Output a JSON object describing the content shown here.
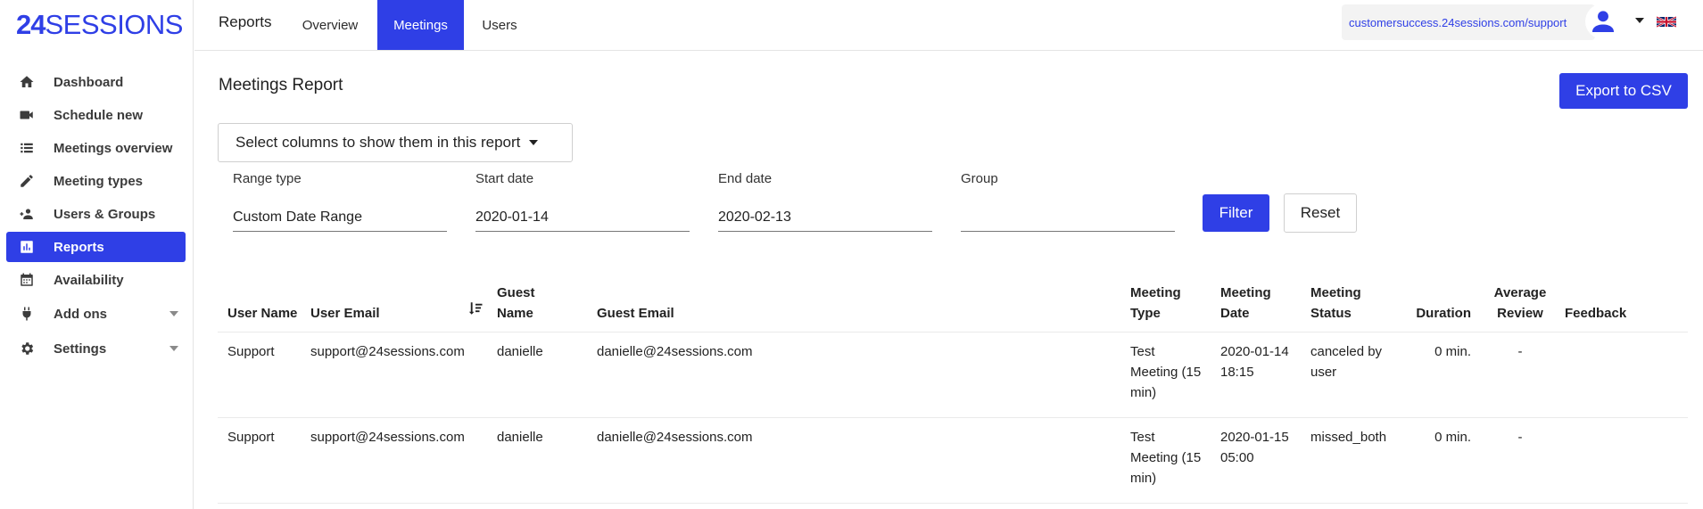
{
  "brand": {
    "logo_bold": "24",
    "logo_light": "SESSIONS",
    "accent": "#2f3fe6"
  },
  "sidebar": {
    "items": [
      {
        "label": "Dashboard",
        "icon": "home-icon"
      },
      {
        "label": "Schedule new",
        "icon": "video-camera-icon"
      },
      {
        "label": "Meetings overview",
        "icon": "list-icon"
      },
      {
        "label": "Meeting types",
        "icon": "pencil-icon"
      },
      {
        "label": "Users & Groups",
        "icon": "users-icon"
      },
      {
        "label": "Reports",
        "icon": "bar-chart-icon",
        "active": true
      },
      {
        "label": "Availability",
        "icon": "calendar-icon"
      },
      {
        "label": "Add ons",
        "icon": "plug-icon",
        "expandable": true
      },
      {
        "label": "Settings",
        "icon": "gear-icon",
        "expandable": true
      }
    ]
  },
  "header": {
    "title": "Reports",
    "tabs": [
      {
        "label": "Overview"
      },
      {
        "label": "Meetings",
        "active": true
      },
      {
        "label": "Users"
      }
    ],
    "url": "customersuccess.24sessions.com/support",
    "language_flag": "uk-flag-icon"
  },
  "main": {
    "title": "Meetings Report",
    "export_label": "Export to CSV",
    "columns_button_label": "Select columns to show them in this report",
    "filters": {
      "range_type": {
        "label": "Range type",
        "value": "Custom Date Range"
      },
      "start_date": {
        "label": "Start date",
        "value": "2020-01-14"
      },
      "end_date": {
        "label": "End date",
        "value": "2020-02-13"
      },
      "group": {
        "label": "Group",
        "value": ""
      }
    },
    "filter_label": "Filter",
    "reset_label": "Reset"
  },
  "table": {
    "headers": {
      "user_name": "User Name",
      "user_email": "User Email",
      "guest_name": "Guest Name",
      "guest_email": "Guest Email",
      "meeting_type": "Meeting Type",
      "meeting_date": "Meeting Date",
      "meeting_status": "Meeting Status",
      "duration": "Duration",
      "average_review": "Average Review",
      "feedback": "Feedback"
    },
    "rows": [
      {
        "user_name": "Support",
        "user_email": "support@24sessions.com",
        "guest_name": "danielle",
        "guest_email": "danielle@24sessions.com",
        "meeting_type": "Test Meeting (15 min)",
        "meeting_date": "2020-01-14 18:15",
        "meeting_status": "canceled by user",
        "duration": "0 min.",
        "average_review": "-",
        "feedback": ""
      },
      {
        "user_name": "Support",
        "user_email": "support@24sessions.com",
        "guest_name": "danielle",
        "guest_email": "danielle@24sessions.com",
        "meeting_type": "Test Meeting (15 min)",
        "meeting_date": "2020-01-15 05:00",
        "meeting_status": "missed_both",
        "duration": "0 min.",
        "average_review": "-",
        "feedback": ""
      }
    ]
  }
}
